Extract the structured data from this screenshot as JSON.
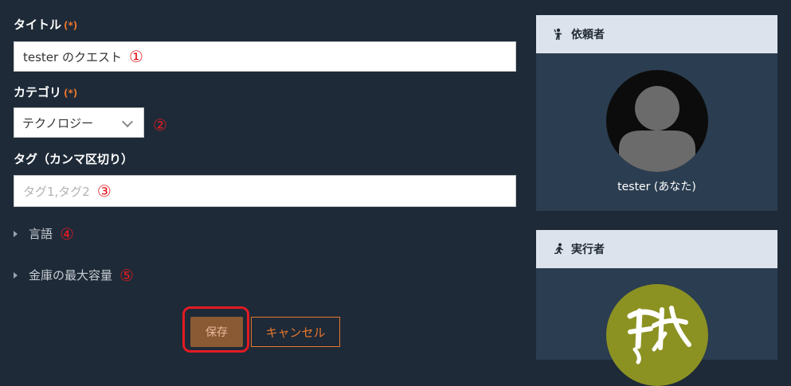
{
  "form": {
    "title_label": "タイトル",
    "required_mark": "(*)",
    "title_value": "tester のクエスト",
    "category_label": "カテゴリ",
    "category_value": "テクノロジー",
    "tags_label": "タグ（カンマ区切り）",
    "tags_placeholder": "タグ1,タグ2",
    "language_label": "言語",
    "max_capacity_label": "金庫の最大容量",
    "save_label": "保存",
    "cancel_label": "キャンセル"
  },
  "markers": [
    "①",
    "②",
    "③",
    "④",
    "⑤"
  ],
  "requester_card": {
    "title": "依頼者",
    "icon": "requester-icon",
    "user_name": "tester (あなた)"
  },
  "executor_card": {
    "title": "実行者",
    "icon": "runner-icon"
  },
  "colors": {
    "background": "#1e2a38",
    "accent": "#e8762d",
    "marker": "#e31b23",
    "card_header": "#dce3ec",
    "card_body": "#2b3d50"
  }
}
